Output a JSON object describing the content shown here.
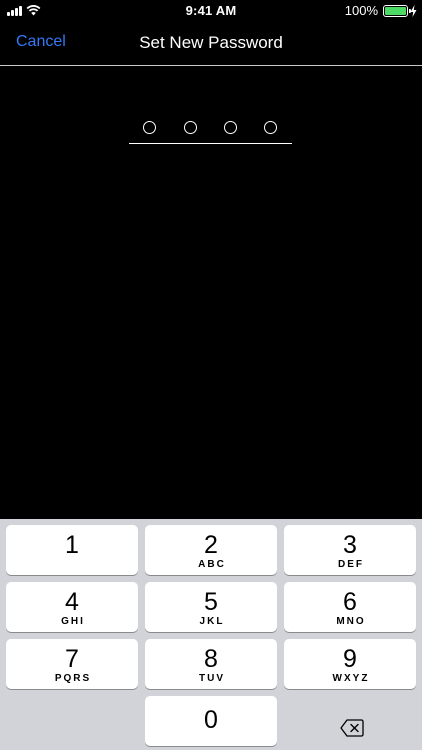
{
  "status_bar": {
    "time": "9:41 AM",
    "battery_percent": "100%",
    "battery_level": 1.0,
    "battery_color": "#4cd964",
    "icons": [
      "cellular-signal-icon",
      "wifi-icon",
      "battery-icon",
      "charging-bolt-icon"
    ]
  },
  "nav": {
    "cancel_label": "Cancel",
    "title": "Set New Password",
    "accent_color": "#3478f6"
  },
  "passcode": {
    "length": 4,
    "entered": 0
  },
  "keypad": {
    "keys": [
      {
        "digit": "1",
        "letters": ""
      },
      {
        "digit": "2",
        "letters": "ABC"
      },
      {
        "digit": "3",
        "letters": "DEF"
      },
      {
        "digit": "4",
        "letters": "GHI"
      },
      {
        "digit": "5",
        "letters": "JKL"
      },
      {
        "digit": "6",
        "letters": "MNO"
      },
      {
        "digit": "7",
        "letters": "PQRS"
      },
      {
        "digit": "8",
        "letters": "TUV"
      },
      {
        "digit": "9",
        "letters": "WXYZ"
      },
      {
        "digit": "0",
        "letters": ""
      }
    ],
    "delete_icon": "backspace-icon"
  }
}
